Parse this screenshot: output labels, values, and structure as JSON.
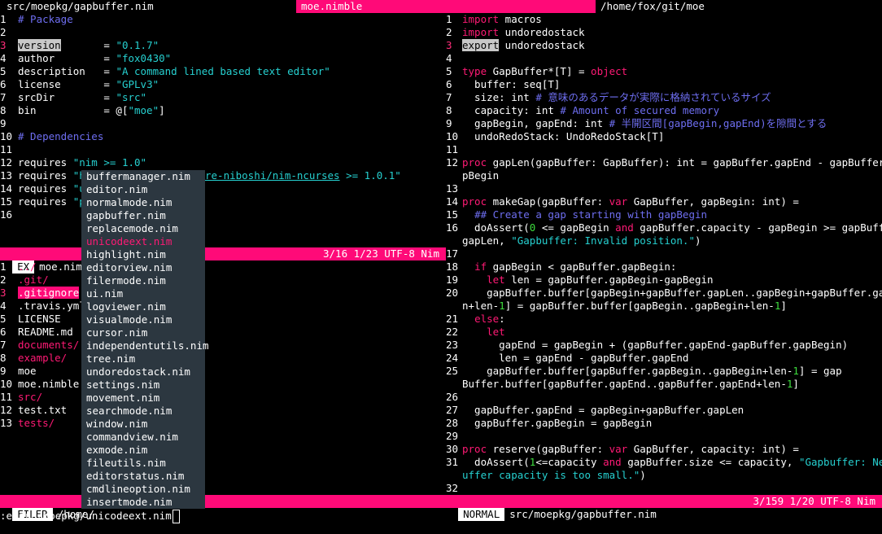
{
  "tabs": {
    "left": "src/moepkg/gapbuffer.nim",
    "active": "moe.nimble",
    "right": "/home/fox/git/moe"
  },
  "left_pane": {
    "lines": [
      {
        "n": "1",
        "t": "# Package",
        "type": "comment"
      },
      {
        "n": "2",
        "t": ""
      },
      {
        "n": "3",
        "k": "version",
        "v": "= \"0.1.7\"",
        "current": true
      },
      {
        "n": "4",
        "k": "author",
        "v": "= \"fox0430\""
      },
      {
        "n": "5",
        "k": "description",
        "v": "= \"A command lined based text editor\""
      },
      {
        "n": "6",
        "k": "license",
        "v": "= \"GPLv3\""
      },
      {
        "n": "7",
        "k": "srcDir",
        "v": "= \"src\""
      },
      {
        "n": "8",
        "k": "bin",
        "v": "= @[\"moe\"]"
      },
      {
        "n": "9",
        "t": ""
      },
      {
        "n": "10",
        "t": "# Dependencies",
        "type": "comment"
      },
      {
        "n": "11",
        "t": ""
      },
      {
        "n": "12",
        "t": "requires \"nim >= 1.0\""
      },
      {
        "n": "13",
        "t": "requires \"h"
      },
      {
        "n": "14",
        "t": "requires \"u"
      },
      {
        "n": "15",
        "t": "requires \"p"
      },
      {
        "n": "16",
        "t": ""
      }
    ],
    "line13_tail": "re-niboshi/nim-ncurses >= 1.0.1\""
  },
  "status_left": {
    "mode": "EX",
    "file": "moe.nimbl",
    "pos": "3/16 1/23 UTF-8 Nim"
  },
  "file_pane": {
    "items": [
      {
        "n": "1",
        "t": "../",
        "type": "dir"
      },
      {
        "n": "2",
        "t": ".git/",
        "type": "dir"
      },
      {
        "n": "3",
        "t": ".gitignore",
        "type": "sel"
      },
      {
        "n": "4",
        "t": ".travis.yml",
        "type": "file"
      },
      {
        "n": "5",
        "t": "LICENSE",
        "type": "file"
      },
      {
        "n": "6",
        "t": "README.md",
        "type": "file"
      },
      {
        "n": "7",
        "t": "documents/",
        "type": "dir"
      },
      {
        "n": "8",
        "t": "example/",
        "type": "dir"
      },
      {
        "n": "9",
        "t": "moe",
        "type": "file"
      },
      {
        "n": "10",
        "t": "moe.nimble",
        "type": "file"
      },
      {
        "n": "11",
        "t": "src/",
        "type": "dir"
      },
      {
        "n": "12",
        "t": "test.txt",
        "type": "file"
      },
      {
        "n": "13",
        "t": "tests/",
        "type": "dir"
      }
    ]
  },
  "status_filer": {
    "mode": "FILER",
    "path": "/home/"
  },
  "popup": {
    "items": [
      "buffermanager.nim",
      "editor.nim",
      "normalmode.nim",
      "gapbuffer.nim",
      "replacemode.nim",
      "unicodeext.nim",
      "highlight.nim",
      "editorview.nim",
      "filermode.nim",
      "ui.nim",
      "logviewer.nim",
      "visualmode.nim",
      "cursor.nim",
      "independentutils.nim",
      "tree.nim",
      "undoredostack.nim",
      "settings.nim",
      "movement.nim",
      "searchmode.nim",
      "window.nim",
      "commandview.nim",
      "exmode.nim",
      "fileutils.nim",
      "editorstatus.nim",
      "cmdlineoption.nim",
      "insertmode.nim"
    ],
    "selected_index": 5
  },
  "right_pane": {
    "lines": [
      {
        "n": "1",
        "h": "<span class='kw'>import</span> macros"
      },
      {
        "n": "2",
        "h": "<span class='kw'>import</span> undoredostack"
      },
      {
        "n": "3",
        "h": "<span class='hl'>export</span> undoredostack"
      },
      {
        "n": "4",
        "h": ""
      },
      {
        "n": "5",
        "h": "<span class='kw'>type</span> GapBuffer*[T] = <span class='kw'>object</span>"
      },
      {
        "n": "6",
        "h": "  buffer: seq[T]"
      },
      {
        "n": "7",
        "h": "  size: int <span class='comment'># 意味のあるデータが実際に格納されているサイズ</span>"
      },
      {
        "n": "8",
        "h": "  capacity: int <span class='comment'># Amount of secured memory</span>"
      },
      {
        "n": "9",
        "h": "  gapBegin, gapEnd: int <span class='comment'># 半開区間[gapBegin,gapEnd)を隙間とする</span>"
      },
      {
        "n": "10",
        "h": "  undoRedoStack: UndoRedoStack[T]"
      },
      {
        "n": "11",
        "h": ""
      },
      {
        "n": "12",
        "h": "<span class='kw'>proc</span> gapLen(gapBuffer: GapBuffer): int = gapBuffer.gapEnd - gapBuffer.ga"
      },
      {
        "n": "",
        "h": "pBegin"
      },
      {
        "n": "13",
        "h": ""
      },
      {
        "n": "14",
        "h": "<span class='kw'>proc</span> makeGap(gapBuffer: <span class='kw'>var</span> GapBuffer, gapBegin: int) ="
      },
      {
        "n": "15",
        "h": "  <span class='comment'>## Create a gap starting with gapBegin</span>"
      },
      {
        "n": "16",
        "h": "  doAssert(<span class='num'>0</span> &lt;= gapBegin <span class='kw'>and</span> gapBuffer.capacity - gapBegin &gt;= gapBuffer."
      },
      {
        "n": "",
        "h": "gapLen, <span class='str'>\"Gapbuffer: Invalid position.\"</span>)"
      },
      {
        "n": "17",
        "h": ""
      },
      {
        "n": "18",
        "h": "  <span class='kw'>if</span> gapBegin &lt; gapBuffer.gapBegin:"
      },
      {
        "n": "19",
        "h": "    <span class='kw'>let</span> len = gapBuffer.gapBegin-gapBegin"
      },
      {
        "n": "20",
        "h": "    gapBuffer.buffer[gapBegin+gapBuffer.gapLen..gapBegin+gapBuffer.gapLe"
      },
      {
        "n": "",
        "h": "n+len-<span class='num'>1</span>] = gapBuffer.buffer[gapBegin..gapBegin+len-<span class='num'>1</span>]"
      },
      {
        "n": "21",
        "h": "  <span class='kw'>else</span>:"
      },
      {
        "n": "22",
        "h": "    <span class='kw'>let</span>"
      },
      {
        "n": "23",
        "h": "      gapEnd = gapBegin + (gapBuffer.gapEnd-gapBuffer.gapBegin)"
      },
      {
        "n": "24",
        "h": "      len = gapEnd - gapBuffer.gapEnd"
      },
      {
        "n": "25",
        "h": "    gapBuffer.buffer[gapBuffer.gapBegin..gapBegin+len-<span class='num'>1</span>] = gap"
      },
      {
        "n": "",
        "h": "Buffer.buffer[gapBuffer.gapEnd..gapBuffer.gapEnd+len-<span class='num'>1</span>]"
      },
      {
        "n": "26",
        "h": ""
      },
      {
        "n": "27",
        "h": "  gapBuffer.gapEnd = gapBegin+gapBuffer.gapLen"
      },
      {
        "n": "28",
        "h": "  gapBuffer.gapBegin = gapBegin"
      },
      {
        "n": "29",
        "h": ""
      },
      {
        "n": "30",
        "h": "<span class='kw'>proc</span> reserve(gapBuffer: <span class='kw'>var</span> GapBuffer, capacity: int) ="
      },
      {
        "n": "31",
        "h": "  doAssert(<span class='num'>1</span>&lt;=capacity <span class='kw'>and</span> gapBuffer.size &lt;= capacity, <span class='str'>\"Gapbuffer: New b</span>"
      },
      {
        "n": "",
        "h": "<span class='str'>uffer capacity is too small.\"</span>)"
      },
      {
        "n": "32",
        "h": ""
      }
    ]
  },
  "status_right": {
    "mode": "NORMAL",
    "file": "src/moepkg/gapbuffer.nim",
    "pos": "3/159 1/20 UTF-8 Nim"
  },
  "cmdline": ":e src/moepkg/unicodeext.nim",
  "colors": {
    "accent": "#ff0a78",
    "comment": "#6e6ef0",
    "string": "#26d0d0",
    "keyword": "#ff1a75",
    "number": "#3ddc3d",
    "popup_bg": "#2c3740"
  }
}
